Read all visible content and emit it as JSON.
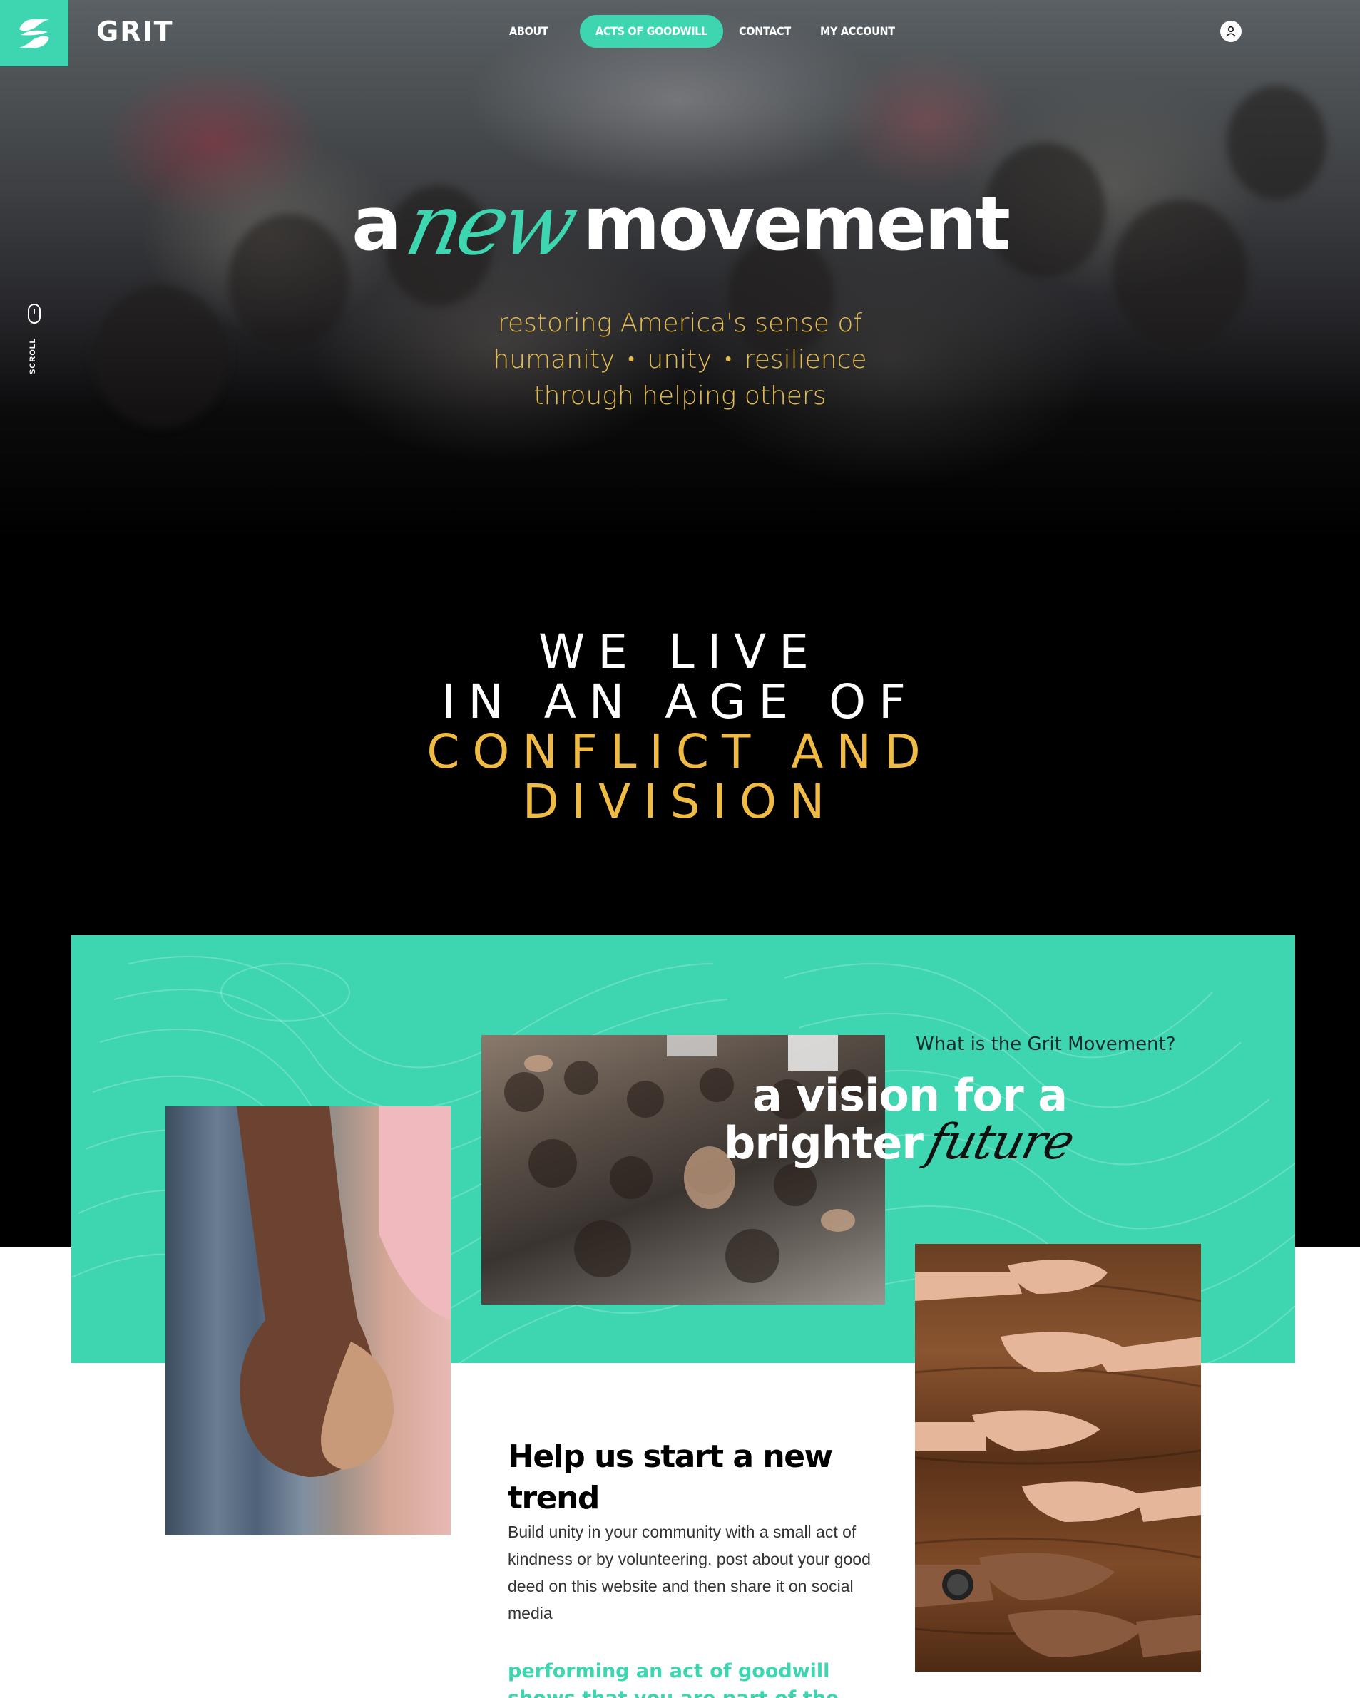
{
  "brand": {
    "name": "GRIT",
    "accent": "#3dd6b0",
    "gold": "#f0bb45"
  },
  "nav": {
    "items": [
      {
        "label": "ABOUT",
        "active": false
      },
      {
        "label": "ACTS OF GOODWILL",
        "active": true
      },
      {
        "label": "CONTACT",
        "active": false
      },
      {
        "label": "MY ACCOUNT",
        "active": false
      }
    ],
    "account_icon": "user-icon"
  },
  "scroll": {
    "label": "SCROLL",
    "icon": "mouse-icon"
  },
  "hero": {
    "title_a": "a",
    "title_new": "new",
    "title_movement": "movement",
    "sub_line1": "restoring America's sense of",
    "sub_humanity": "humanity",
    "sub_unity": "unity",
    "sub_resilience": "resilience",
    "sub_line3": "through helping others"
  },
  "age": {
    "line1": "WE LIVE",
    "line2": "IN AN AGE OF",
    "line3": "CONFLICT AND",
    "line4": "DIVISION"
  },
  "vision": {
    "eyebrow": "What is the Grit Movement?",
    "line1": "a vision for a",
    "line2": "brighter",
    "future": "future"
  },
  "help": {
    "title": "Help us start a new trend",
    "body": "Build unity in your community with a small act of kindness or by volunteering. post about your good deed on this website and then share it on social media",
    "cta": "performing an act of goodwill shows that you are part of the movement"
  }
}
